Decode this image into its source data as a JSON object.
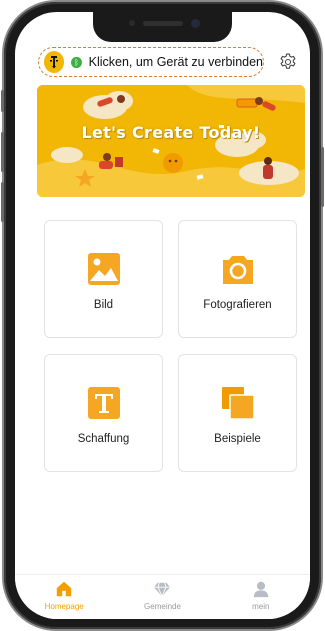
{
  "header": {
    "connect_text": "Klicken, um Gerät zu verbinden"
  },
  "banner": {
    "title": "Let's Create Today!"
  },
  "grid": {
    "items": [
      {
        "label": "Bild",
        "icon": "image-icon"
      },
      {
        "label": "Fotografieren",
        "icon": "camera-icon"
      },
      {
        "label": "Schaffung",
        "icon": "text-icon"
      },
      {
        "label": "Beispiele",
        "icon": "copy-icon"
      }
    ]
  },
  "nav": {
    "items": [
      {
        "label": "Homepage",
        "icon": "home-icon",
        "active": true
      },
      {
        "label": "Gemeinde",
        "icon": "diamond-icon",
        "active": false
      },
      {
        "label": "mein",
        "icon": "user-icon",
        "active": false
      }
    ]
  },
  "colors": {
    "accent": "#f2b705",
    "icon_orange": "#f5a623",
    "active_nav": "#f2a000",
    "connect_border": "#e07a2e",
    "status_green": "#3cb043"
  }
}
